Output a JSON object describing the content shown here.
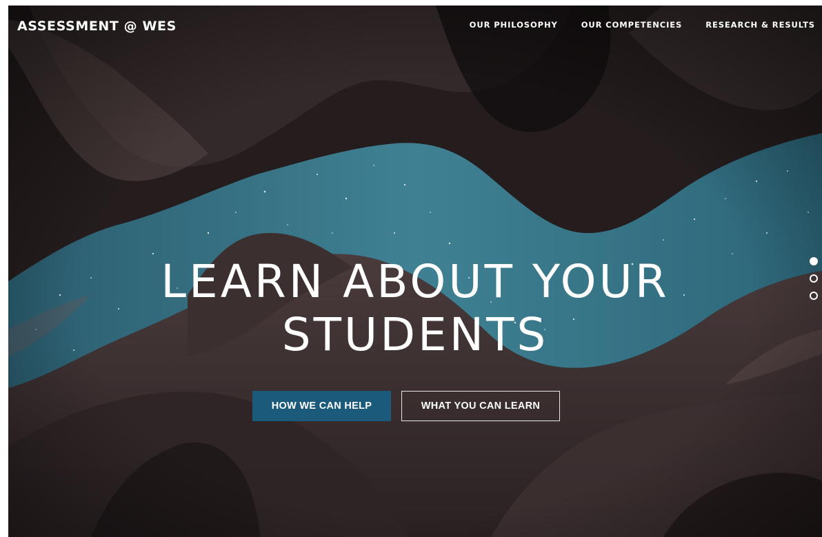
{
  "site": {
    "brand": "ASSESSMENT @ WES"
  },
  "nav": {
    "items": [
      {
        "label": "OUR PHILOSOPHY"
      },
      {
        "label": "OUR COMPETENCIES"
      },
      {
        "label": "RESEARCH & RESULTS"
      }
    ]
  },
  "hero": {
    "headline_line1": "LEARN ABOUT YOUR",
    "headline_line2": "STUDENTS",
    "primary_button": "HOW WE CAN HELP",
    "secondary_button": "WHAT YOU CAN LEARN",
    "slides": {
      "count": 3,
      "active": 1
    },
    "background_description": "photo"
  },
  "colors": {
    "primary_button": "#1b5a7a",
    "text": "#ffffff",
    "background": "#1b1516"
  }
}
